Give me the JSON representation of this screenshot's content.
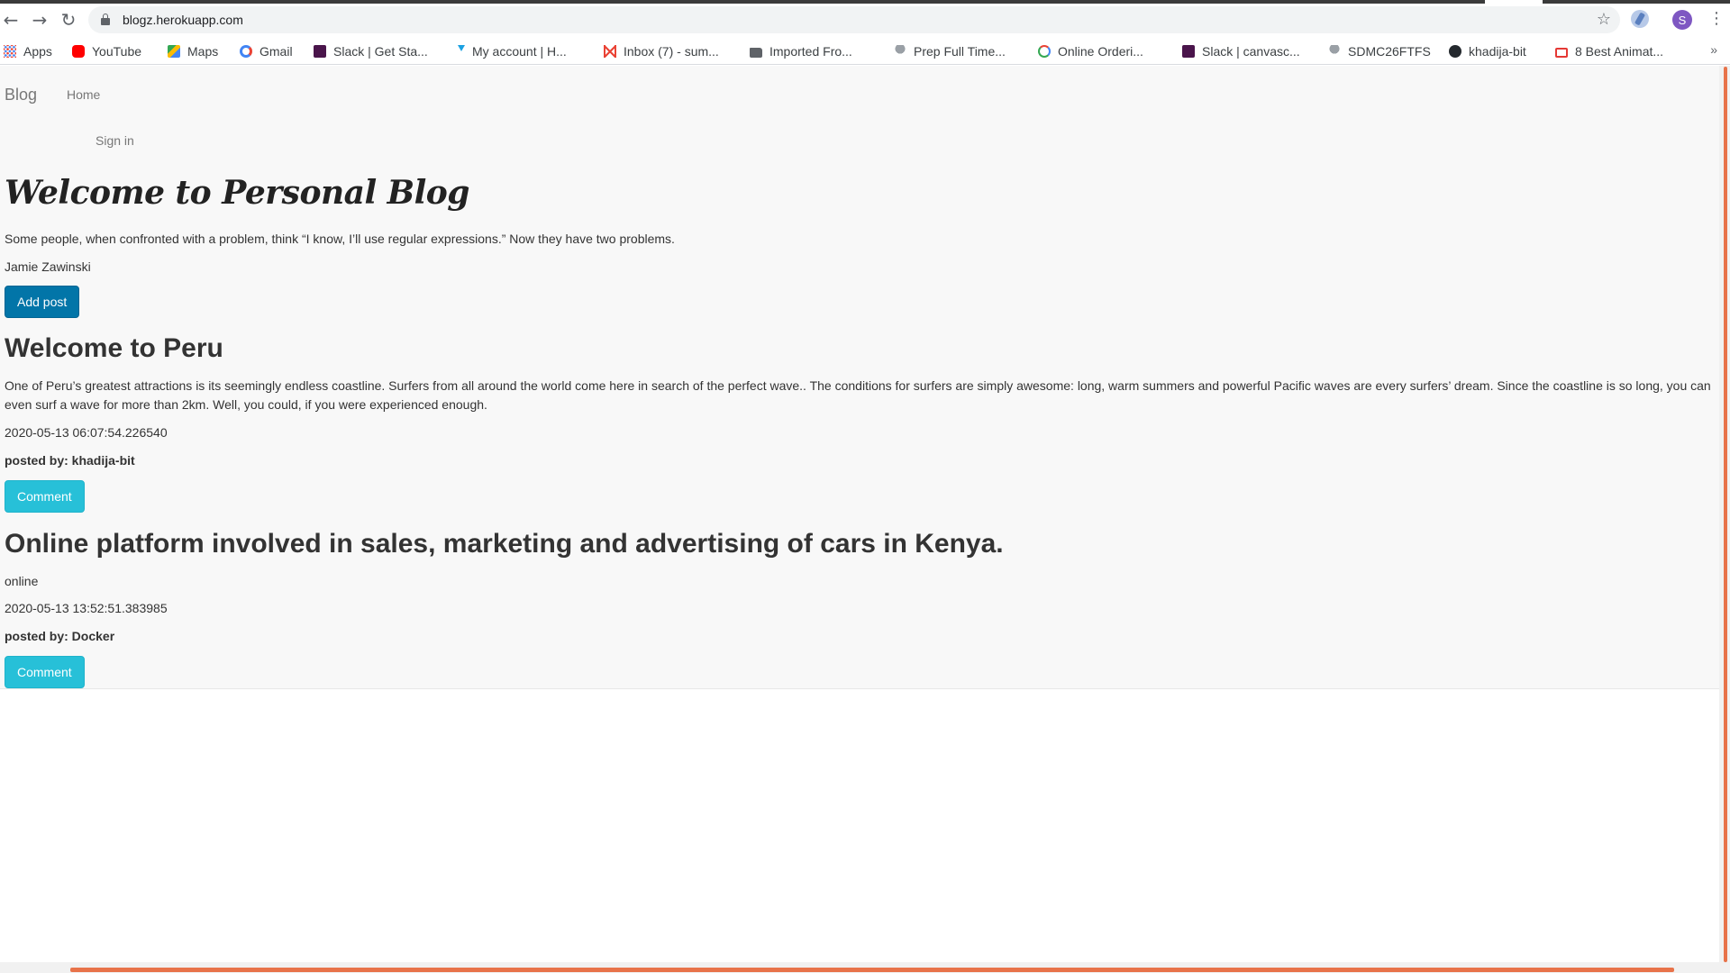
{
  "browser": {
    "url": "blogz.herokuapp.com",
    "profile_initial": "S",
    "bookmarks": [
      {
        "label": "Apps",
        "icon": "apps-grid-icon"
      },
      {
        "label": "YouTube",
        "icon": "youtube-icon"
      },
      {
        "label": "Maps",
        "icon": "maps-icon"
      },
      {
        "label": "Gmail",
        "icon": "google-icon"
      },
      {
        "label": "Slack | Get Sta...",
        "icon": "slack-icon"
      },
      {
        "label": "My account | H...",
        "icon": "hackerrank-icon"
      },
      {
        "label": "Inbox (7) - sum...",
        "icon": "gmail-icon"
      },
      {
        "label": "Imported Fro...",
        "icon": "folder-icon"
      },
      {
        "label": "Prep Full Time...",
        "icon": "palm-icon"
      },
      {
        "label": "Online Orderi...",
        "icon": "circle-loader-icon"
      },
      {
        "label": "Slack | canvasc...",
        "icon": "slack-icon"
      },
      {
        "label": "SDMC26FTFS",
        "icon": "palm-icon"
      },
      {
        "label": "khadija-bit",
        "icon": "github-icon"
      },
      {
        "label": "8 Best Animat...",
        "icon": "mail-icon"
      }
    ],
    "more": "»"
  },
  "nav": {
    "brand": "Blog",
    "home": "Home",
    "signin": "Sign in"
  },
  "hero": {
    "title": "Welcome to Personal Blog",
    "quote": "Some people, when confronted with a problem, think “I know, I’ll use regular expressions.” Now they have two problems.",
    "author": "Jamie Zawinski",
    "add_post": "Add post"
  },
  "posts": [
    {
      "title": "Welcome to Peru",
      "body": "One of Peru’s greatest attractions is its seemingly endless coastline. Surfers from all around the world come here in search of the perfect wave.. The conditions for surfers are simply awesome: long, warm summers and powerful Pacific waves are every surfers’ dream. Since the coastline is so long, you can even surf a wave for more than 2km. Well, you could, if you were experienced enough.",
      "date": "2020-05-13 06:07:54.226540",
      "posted_by": "posted by: khadija-bit",
      "comment": "Comment"
    },
    {
      "title": "Online platform involved in sales, marketing and advertising of cars in Kenya.",
      "body": "online",
      "date": "2020-05-13 13:52:51.383985",
      "posted_by": "posted by: Docker",
      "comment": "Comment"
    }
  ],
  "colors": {
    "primary_button": "#0275a8",
    "info_button": "#27c0d8",
    "scroll_accent": "#e8734a"
  }
}
